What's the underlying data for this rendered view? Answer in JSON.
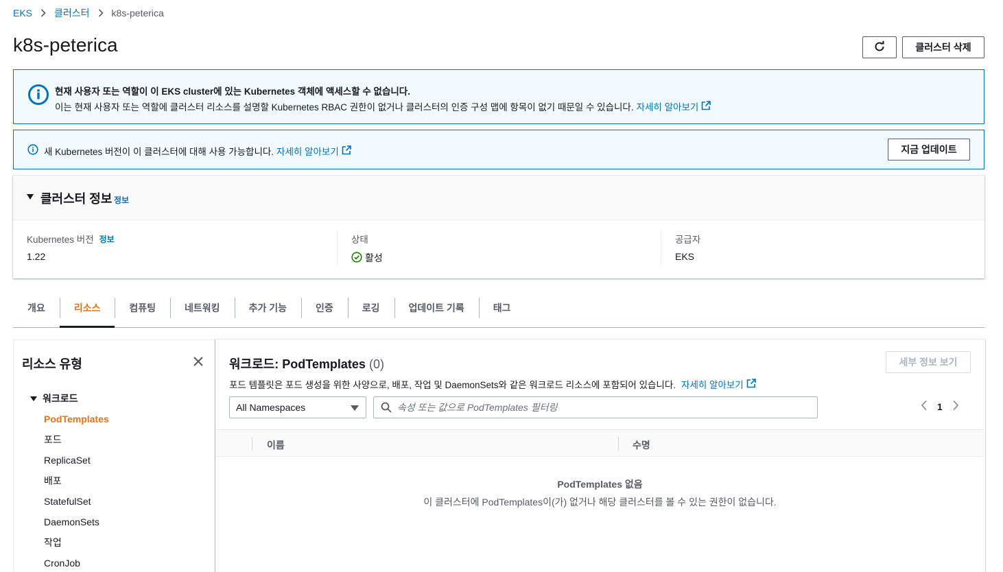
{
  "breadcrumb": {
    "root": "EKS",
    "clusters": "클러스터",
    "current": "k8s-peterica"
  },
  "page": {
    "title": "k8s-peterica",
    "delete_label": "클러스터 삭제"
  },
  "alert_access": {
    "heading": "현재 사용자 또는 역할이 이 EKS cluster에 있는 Kubernetes 객체에 액세스할 수 없습니다.",
    "message": "이는 현재 사용자 또는 역할에 클러스터 리소스를 설명할 Kubernetes RBAC 권한이 없거나 클러스터의 인증 구성 맵에 항목이 없기 때문일 수 있습니다.",
    "link": "자세히 알아보기"
  },
  "alert_version": {
    "message": "새 Kubernetes 버전이 이 클러스터에 대해 사용 가능합니다.",
    "link": "자세히 알아보기",
    "button": "지금 업데이트"
  },
  "cluster_info": {
    "title": "클러스터 정보",
    "info": "정보",
    "k8s_label": "Kubernetes 버전",
    "k8s_info": "정보",
    "k8s_value": "1.22",
    "status_label": "상태",
    "status_value": "활성",
    "provider_label": "공급자",
    "provider_value": "EKS"
  },
  "tabs": [
    "개요",
    "리소스",
    "컴퓨팅",
    "네트워킹",
    "추가 기능",
    "인증",
    "로깅",
    "업데이트 기록",
    "태그"
  ],
  "active_tab": "리소스",
  "resource_types": {
    "title": "리소스 유형",
    "group": "워크로드",
    "items": [
      "PodTemplates",
      "포드",
      "ReplicaSet",
      "배포",
      "StatefulSet",
      "DaemonSets",
      "작업",
      "CronJob"
    ],
    "active_item": "PodTemplates"
  },
  "workload": {
    "title": "워크로드: PodTemplates",
    "count": "(0)",
    "description": "포드 템플릿은 포드 생성을 위한 사양으로, 배포, 작업 및 DaemonSets와 같은 워크로드 리소스에 포함되어 있습니다.",
    "link": "자세히 알아보기",
    "details_button": "세부 정보 보기",
    "namespace_select": "All Namespaces",
    "filter_placeholder": "속성 또는 값으로 PodTemplates 필터링",
    "page": "1",
    "columns": [
      "이름",
      "수명"
    ],
    "empty_title": "PodTemplates 없음",
    "empty_message": "이 클러스터에 PodTemplates이(가) 없거나 해당 클러스터를 볼 수 있는 권한이 없습니다."
  },
  "colors": {
    "link": "#0073bb",
    "accent": "#ec7211",
    "success": "#1d8102",
    "info_bg": "#f1faff"
  }
}
